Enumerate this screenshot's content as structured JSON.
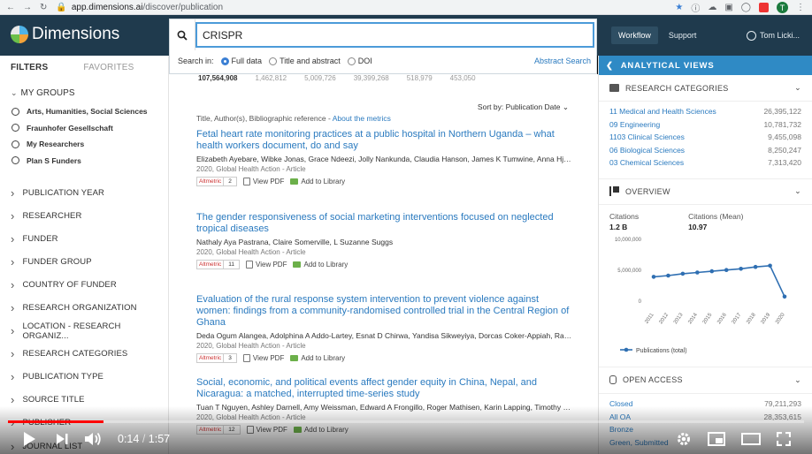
{
  "browser": {
    "url_host": "app.dimensions.ai",
    "url_path": "/discover/publication",
    "profile_initial": "T"
  },
  "header": {
    "logo_text": "Dimensions",
    "workflow": "Workflow",
    "support": "Support",
    "user": "Tom Licki..."
  },
  "search": {
    "query": "CRISPR",
    "search_in_label": "Search in:",
    "options": [
      "Full data",
      "Title and abstract",
      "DOI"
    ],
    "selected": "Full data",
    "abstract_search": "Abstract Search"
  },
  "sidebar": {
    "tab_filters": "FILTERS",
    "tab_favorites": "FAVORITES",
    "my_groups": "MY GROUPS",
    "groups": [
      "Arts, Humanities, Social Sciences",
      "Fraunhofer Gesellschaft",
      "My Researchers",
      "Plan S Funders"
    ],
    "facets": [
      "PUBLICATION YEAR",
      "RESEARCHER",
      "FUNDER",
      "FUNDER GROUP",
      "COUNTRY OF FUNDER",
      "RESEARCH ORGANIZATION",
      "LOCATION - RESEARCH ORGANIZ...",
      "RESEARCH CATEGORIES",
      "PUBLICATION TYPE",
      "SOURCE TITLE",
      "PUBLISHER",
      "JOURNAL LIST"
    ]
  },
  "main": {
    "stats": [
      "107,564,908",
      "1,462,812",
      "5,009,726",
      "39,399,268",
      "518,979",
      "453,050"
    ],
    "sort_label": "Sort by:",
    "sort_value": "Publication Date",
    "meta_header": "Title, Author(s), Bibliographic reference - ",
    "about_metrics": "About the metrics",
    "altmetric_label": "Altmetric",
    "view_pdf": "View PDF",
    "add_library": "Add to Library",
    "results": [
      {
        "title": "Fetal heart rate monitoring practices at a public hospital in Northern Uganda – what health workers document, do and say",
        "authors": "Elizabeth Ayebare, Wibke Jonas, Grace Ndeezi, Jolly Nankunda, Claudia Hanson, James K Tumwine, Anna Hjelms...",
        "source": "2020, Global Health Action - Article",
        "altmetric": "2"
      },
      {
        "title": "The gender responsiveness of social marketing interventions focused on neglected tropical diseases",
        "authors": "Nathaly Aya Pastrana, Claire Somerville, L Suzanne Suggs",
        "source": "2020, Global Health Action - Article",
        "altmetric": "11"
      },
      {
        "title": "Evaluation of the rural response system intervention to prevent violence against women: findings from a community-randomised controlled trial in the Central Region of Ghana",
        "authors": "Deda Ogum Alangea, Adolphina A Addo-Lartey, Esnat D Chirwa, Yandisa Sikweyiya, Dorcas Coker-Appiah, Rachel ...",
        "source": "2020, Global Health Action - Article",
        "altmetric": "3"
      },
      {
        "title": "Social, economic, and political events affect gender equity in China, Nepal, and Nicaragua: a matched, interrupted time-series study",
        "authors": "Tuan T Nguyen, Ashley Darnell, Amy Weissman, Edward A Frongillo, Roger Mathisen, Karin Lapping, Timothy D Ma...",
        "source": "2020, Global Health Action - Article",
        "altmetric": "12"
      }
    ]
  },
  "right_panel": {
    "analytical_views": "ANALYTICAL VIEWS",
    "research_categories": "RESEARCH CATEGORIES",
    "categories": [
      {
        "label": "11 Medical and Health Sciences",
        "value": "26,395,122"
      },
      {
        "label": "09 Engineering",
        "value": "10,781,732"
      },
      {
        "label": "1103 Clinical Sciences",
        "value": "9,455,098"
      },
      {
        "label": "06 Biological Sciences",
        "value": "8,250,247"
      },
      {
        "label": "03 Chemical Sciences",
        "value": "7,313,420"
      }
    ],
    "overview": "OVERVIEW",
    "citations_label": "Citations",
    "citations_value": "1.2 B",
    "citations_mean_label": "Citations (Mean)",
    "citations_mean_value": "10.97",
    "open_access": "OPEN ACCESS",
    "oa_items": [
      {
        "label": "Closed",
        "value": "79,211,293"
      },
      {
        "label": "All OA",
        "value": "28,353,615"
      },
      {
        "label": "Bronze",
        "value": ""
      },
      {
        "label": "Green, Submitted",
        "value": ""
      }
    ]
  },
  "chart_data": {
    "type": "line",
    "categories": [
      "2011",
      "2012",
      "2013",
      "2014",
      "2015",
      "2016",
      "2017",
      "2018",
      "2019",
      "2020"
    ],
    "series": [
      {
        "name": "Publications (total)",
        "values": [
          3800000,
          4000000,
          4300000,
          4500000,
          4700000,
          4900000,
          5100000,
          5400000,
          5600000,
          600000
        ]
      }
    ],
    "y_ticks": [
      "10,000,000",
      "5,000,000",
      "0"
    ],
    "ylim": [
      0,
      10000000
    ],
    "color": "#2f6fb2",
    "legend": "bottom-left"
  },
  "video": {
    "current": "0:14",
    "sep": "/",
    "duration": "1:57",
    "progress_fraction": 0.12
  }
}
